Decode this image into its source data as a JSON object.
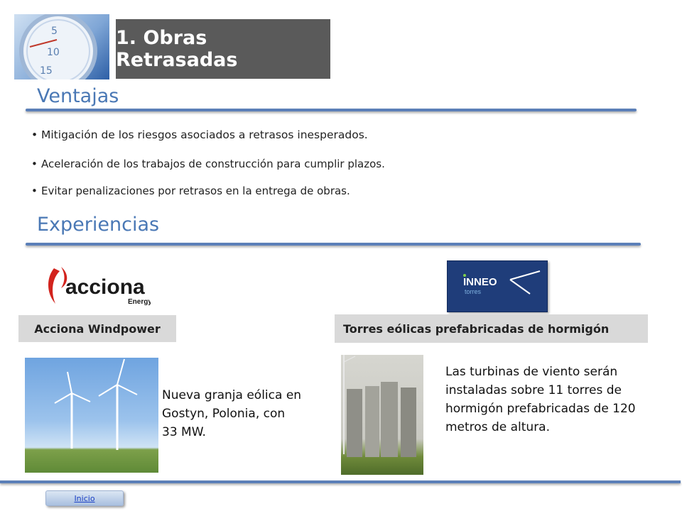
{
  "title": "1. Obras Retrasadas",
  "ventajas": {
    "heading": "Ventajas",
    "bullets": [
      "Mitigación de los riesgos asociados a retrasos inesperados.",
      "Aceleración de los trabajos de construcción para cumplir plazos.",
      "Evitar penalizaciones por retrasos en la entrega de obras."
    ]
  },
  "experiencias": {
    "heading": "Experiencias",
    "acciona": {
      "logo_word": "acciona",
      "logo_sub": "Energy",
      "label": "Acciona Windpower",
      "caption": "Nueva granja eólica en Gostyn, Polonia, con 33 MW."
    },
    "inneo": {
      "logo_word": "INNEO",
      "logo_sub": "torres",
      "label": "Torres eólicas prefabricadas de hormigón",
      "caption": "Las turbinas de viento serán instaladas sobre 11 torres de hormigón  prefabricadas de 120 metros de altura."
    }
  },
  "stopwatch_numbers": [
    "5",
    "10",
    "15"
  ],
  "footer": {
    "inicio_label": "Inicio"
  },
  "colors": {
    "accent": "#4a78b5",
    "rule": "#5b7fb8",
    "title_bg": "#5a5a5a",
    "acciona_red": "#d2231d",
    "inneo_bg": "#1f3d7a"
  }
}
